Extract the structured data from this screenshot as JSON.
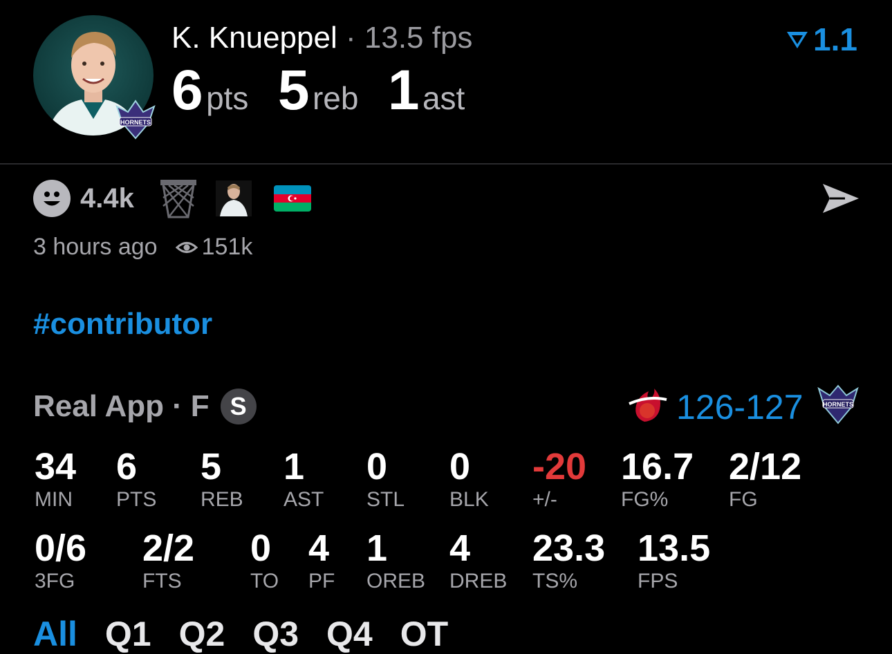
{
  "header": {
    "player_name": "K. Knueppel",
    "separator": "·",
    "fps": "13.5 fps",
    "points": "6",
    "points_unit": "pts",
    "rebounds": "5",
    "rebounds_unit": "reb",
    "assists": "1",
    "assists_unit": "ast",
    "rating": "1.1",
    "team_badge_text": "HORNETS"
  },
  "reactions": {
    "count": "4.4k",
    "time_ago": "3 hours ago",
    "views": "151k"
  },
  "hashtag": "#contributor",
  "game": {
    "source": "Real App",
    "separator": "·",
    "status": "F",
    "badge": "S",
    "score": "126-127"
  },
  "stats_row1": [
    {
      "value": "34",
      "label": "MIN"
    },
    {
      "value": "6",
      "label": "PTS"
    },
    {
      "value": "5",
      "label": "REB"
    },
    {
      "value": "1",
      "label": "AST"
    },
    {
      "value": "0",
      "label": "STL"
    },
    {
      "value": "0",
      "label": "BLK"
    },
    {
      "value": "-20",
      "label": "+/-"
    },
    {
      "value": "16.7",
      "label": "FG%"
    },
    {
      "value": "2/12",
      "label": "FG"
    }
  ],
  "stats_row2": [
    {
      "value": "0/6",
      "label": "3FG"
    },
    {
      "value": "2/2",
      "label": "FTS"
    },
    {
      "value": "0",
      "label": "TO"
    },
    {
      "value": "4",
      "label": "PF"
    },
    {
      "value": "1",
      "label": "OREB"
    },
    {
      "value": "4",
      "label": "DREB"
    },
    {
      "value": "23.3",
      "label": "TS%"
    },
    {
      "value": "13.5",
      "label": "FPS"
    }
  ],
  "tabs": [
    {
      "label": "All",
      "active": true
    },
    {
      "label": "Q1"
    },
    {
      "label": "Q2"
    },
    {
      "label": "Q3"
    },
    {
      "label": "Q4"
    },
    {
      "label": "OT"
    }
  ],
  "colors": {
    "accent": "#1a8fe0",
    "negative": "#e23a3a",
    "muted": "#a6a6ab",
    "background": "#000000"
  },
  "icons": [
    "player-avatar",
    "hornets-logo-icon",
    "rating-arrow-icon",
    "smile-icon",
    "hoop-icon",
    "mini-player-icon",
    "azerbaijan-flag-icon",
    "send-icon",
    "eye-icon",
    "heat-logo-icon"
  ]
}
